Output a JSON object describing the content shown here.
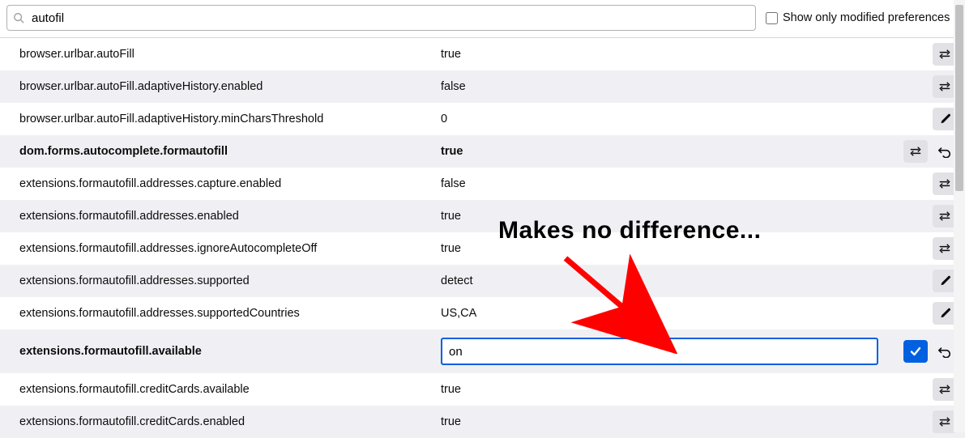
{
  "search": {
    "value": "autofil"
  },
  "showModified": {
    "label": "Show only modified preferences",
    "checked": false
  },
  "prefs": [
    {
      "name": "browser.urlbar.autoFill",
      "value": "true",
      "action": "toggle",
      "bold": false,
      "reset": false,
      "editing": false
    },
    {
      "name": "browser.urlbar.autoFill.adaptiveHistory.enabled",
      "value": "false",
      "action": "toggle",
      "bold": false,
      "reset": false,
      "editing": false
    },
    {
      "name": "browser.urlbar.autoFill.adaptiveHistory.minCharsThreshold",
      "value": "0",
      "action": "edit",
      "bold": false,
      "reset": false,
      "editing": false
    },
    {
      "name": "dom.forms.autocomplete.formautofill",
      "value": "true",
      "action": "toggle",
      "bold": true,
      "reset": true,
      "editing": false
    },
    {
      "name": "extensions.formautofill.addresses.capture.enabled",
      "value": "false",
      "action": "toggle",
      "bold": false,
      "reset": false,
      "editing": false
    },
    {
      "name": "extensions.formautofill.addresses.enabled",
      "value": "true",
      "action": "toggle",
      "bold": false,
      "reset": false,
      "editing": false
    },
    {
      "name": "extensions.formautofill.addresses.ignoreAutocompleteOff",
      "value": "true",
      "action": "toggle",
      "bold": false,
      "reset": false,
      "editing": false
    },
    {
      "name": "extensions.formautofill.addresses.supported",
      "value": "detect",
      "action": "edit",
      "bold": false,
      "reset": false,
      "editing": false
    },
    {
      "name": "extensions.formautofill.addresses.supportedCountries",
      "value": "US,CA",
      "action": "edit",
      "bold": false,
      "reset": false,
      "editing": false
    },
    {
      "name": "extensions.formautofill.available",
      "value": "on",
      "action": "save",
      "bold": true,
      "reset": true,
      "editing": true
    },
    {
      "name": "extensions.formautofill.creditCards.available",
      "value": "true",
      "action": "toggle",
      "bold": false,
      "reset": false,
      "editing": false
    },
    {
      "name": "extensions.formautofill.creditCards.enabled",
      "value": "true",
      "action": "toggle",
      "bold": false,
      "reset": false,
      "editing": false
    }
  ],
  "annotation": {
    "text": "Makes no difference..."
  },
  "icons": {
    "toggle": "toggle-icon",
    "edit": "pencil-icon",
    "save": "check-icon",
    "reset": "undo-icon"
  }
}
